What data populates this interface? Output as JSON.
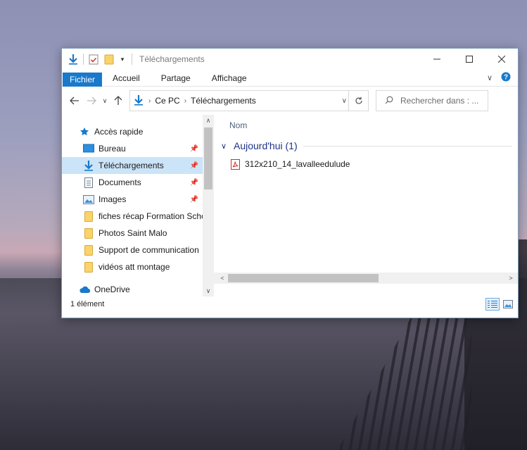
{
  "window": {
    "title": "Téléchargements"
  },
  "ribbon": {
    "tabs": [
      {
        "label": "Fichier",
        "active": true
      },
      {
        "label": "Accueil"
      },
      {
        "label": "Partage"
      },
      {
        "label": "Affichage"
      }
    ]
  },
  "address": {
    "segments": [
      "Ce PC",
      "Téléchargements"
    ]
  },
  "search": {
    "placeholder": "Rechercher dans : ..."
  },
  "navpane": {
    "items": [
      {
        "label": "Accès rapide",
        "icon": "star-icon"
      },
      {
        "label": "Bureau",
        "icon": "desktop-icon",
        "pinned": true
      },
      {
        "label": "Téléchargements",
        "icon": "download-icon",
        "pinned": true,
        "selected": true
      },
      {
        "label": "Documents",
        "icon": "document-icon",
        "pinned": true
      },
      {
        "label": "Images",
        "icon": "image-icon",
        "pinned": true
      },
      {
        "label": "fiches récap Formation Scho",
        "icon": "folder-icon"
      },
      {
        "label": "Photos Saint Malo",
        "icon": "folder-icon"
      },
      {
        "label": "Support de communication",
        "icon": "folder-icon"
      },
      {
        "label": "vidéos att montage",
        "icon": "folder-icon"
      },
      {
        "label": "OneDrive",
        "icon": "cloud-icon"
      }
    ]
  },
  "content": {
    "column_name": "Nom",
    "group_label": "Aujourd'hui (1)",
    "files": [
      {
        "name": "312x210_14_lavalleedulude",
        "icon": "pdf-icon"
      }
    ]
  },
  "status": {
    "item_count": "1 élément"
  },
  "colors": {
    "accent": "#1979ca",
    "selection": "#cce4f7",
    "group_text": "#1e3287"
  }
}
